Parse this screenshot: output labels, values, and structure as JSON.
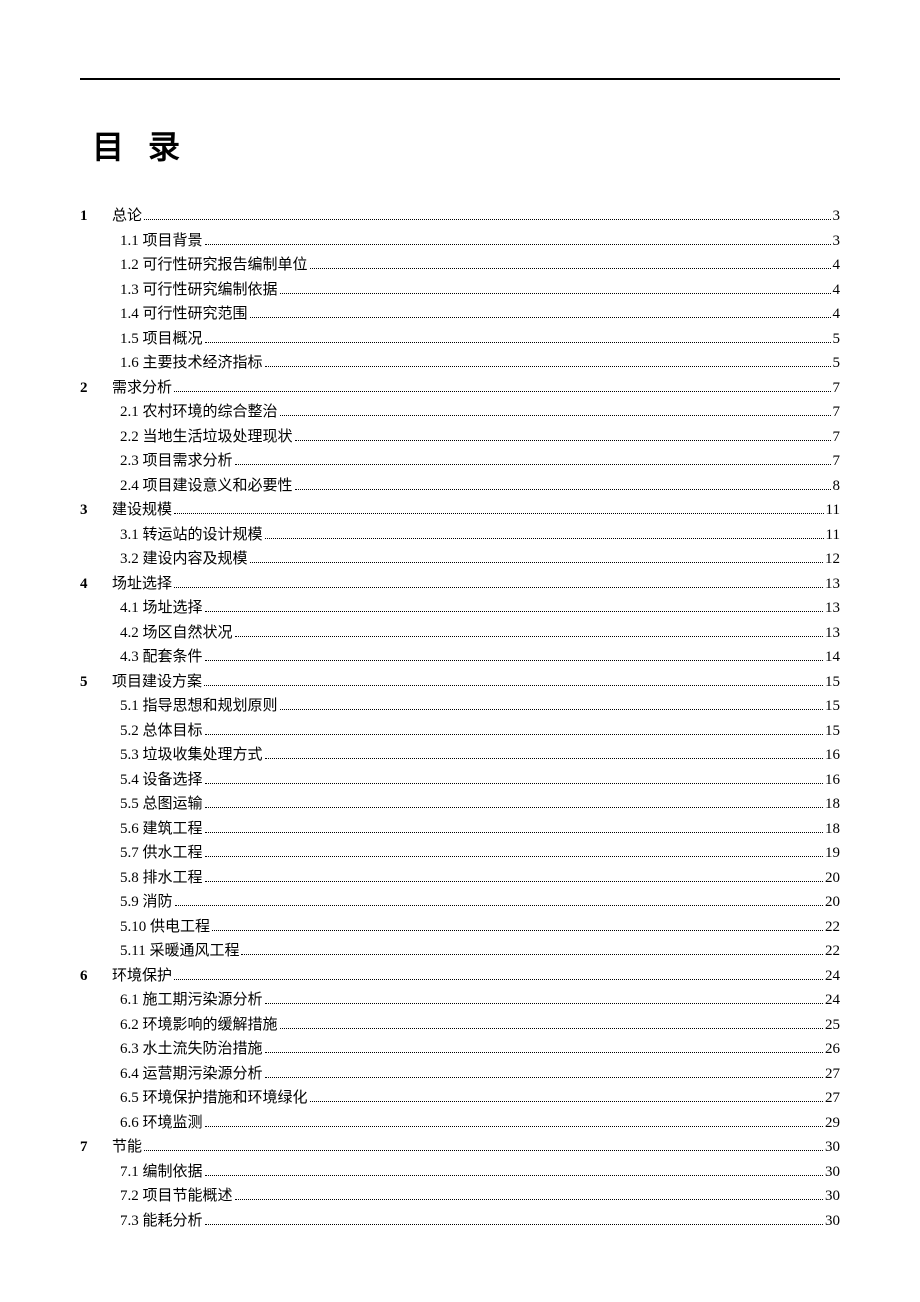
{
  "title": "目录",
  "toc": [
    {
      "level": 1,
      "num": "1",
      "label": "总论",
      "page": "3"
    },
    {
      "level": 2,
      "num": "",
      "label": "1.1 项目背景",
      "page": "3"
    },
    {
      "level": 2,
      "num": "",
      "label": "1.2 可行性研究报告编制单位",
      "page": "4"
    },
    {
      "level": 2,
      "num": "",
      "label": "1.3 可行性研究编制依据",
      "page": "4"
    },
    {
      "level": 2,
      "num": "",
      "label": "1.4 可行性研究范围",
      "page": "4"
    },
    {
      "level": 2,
      "num": "",
      "label": "1.5 项目概况",
      "page": "5"
    },
    {
      "level": 2,
      "num": "",
      "label": "1.6 主要技术经济指标",
      "page": "5"
    },
    {
      "level": 1,
      "num": "2",
      "label": "需求分析",
      "page": "7"
    },
    {
      "level": 2,
      "num": "",
      "label": "2.1 农村环境的综合整治",
      "page": "7"
    },
    {
      "level": 2,
      "num": "",
      "label": "2.2 当地生活垃圾处理现状",
      "page": "7"
    },
    {
      "level": 2,
      "num": "",
      "label": "2.3 项目需求分析",
      "page": "7"
    },
    {
      "level": 2,
      "num": "",
      "label": "2.4 项目建设意义和必要性",
      "page": "8"
    },
    {
      "level": 1,
      "num": "3",
      "label": "建设规模",
      "page": "11"
    },
    {
      "level": 2,
      "num": "",
      "label": "3.1 转运站的设计规模",
      "page": "11"
    },
    {
      "level": 2,
      "num": "",
      "label": "3.2 建设内容及规模",
      "page": "12"
    },
    {
      "level": 1,
      "num": "4",
      "label": "场址选择",
      "page": "13"
    },
    {
      "level": 2,
      "num": "",
      "label": "4.1 场址选择",
      "page": "13"
    },
    {
      "level": 2,
      "num": "",
      "label": "4.2 场区自然状况",
      "page": "13"
    },
    {
      "level": 2,
      "num": "",
      "label": "4.3 配套条件",
      "page": "14"
    },
    {
      "level": 1,
      "num": "5",
      "label": "项目建设方案",
      "page": "15"
    },
    {
      "level": 2,
      "num": "",
      "label": "5.1 指导思想和规划原则",
      "page": "15"
    },
    {
      "level": 2,
      "num": "",
      "label": "5.2 总体目标",
      "page": "15"
    },
    {
      "level": 2,
      "num": "",
      "label": "5.3 垃圾收集处理方式",
      "page": "16"
    },
    {
      "level": 2,
      "num": "",
      "label": "5.4 设备选择",
      "page": "16"
    },
    {
      "level": 2,
      "num": "",
      "label": "5.5 总图运输",
      "page": "18"
    },
    {
      "level": 2,
      "num": "",
      "label": "5.6 建筑工程",
      "page": "18"
    },
    {
      "level": 2,
      "num": "",
      "label": "5.7 供水工程",
      "page": "19"
    },
    {
      "level": 2,
      "num": "",
      "label": "5.8 排水工程",
      "page": "20"
    },
    {
      "level": 2,
      "num": "",
      "label": "5.9 消防",
      "page": "20"
    },
    {
      "level": 2,
      "num": "",
      "label": "5.10 供电工程",
      "page": "22"
    },
    {
      "level": 2,
      "num": "",
      "label": "5.11 采暖通风工程",
      "page": "22"
    },
    {
      "level": 1,
      "num": "6",
      "label": "环境保护",
      "page": "24"
    },
    {
      "level": 2,
      "num": "",
      "label": "6.1 施工期污染源分析",
      "page": "24"
    },
    {
      "level": 2,
      "num": "",
      "label": "6.2 环境影响的缓解措施",
      "page": "25"
    },
    {
      "level": 2,
      "num": "",
      "label": "6.3 水土流失防治措施",
      "page": "26"
    },
    {
      "level": 2,
      "num": "",
      "label": "6.4 运营期污染源分析",
      "page": "27"
    },
    {
      "level": 2,
      "num": "",
      "label": "6.5 环境保护措施和环境绿化",
      "page": "27"
    },
    {
      "level": 2,
      "num": "",
      "label": "6.6 环境监测",
      "page": "29"
    },
    {
      "level": 1,
      "num": "7",
      "label": "节能",
      "page": "30"
    },
    {
      "level": 2,
      "num": "",
      "label": "7.1 编制依据",
      "page": "30"
    },
    {
      "level": 2,
      "num": "",
      "label": "7.2 项目节能概述",
      "page": "30"
    },
    {
      "level": 2,
      "num": "",
      "label": "7.3 能耗分析",
      "page": "30"
    }
  ]
}
